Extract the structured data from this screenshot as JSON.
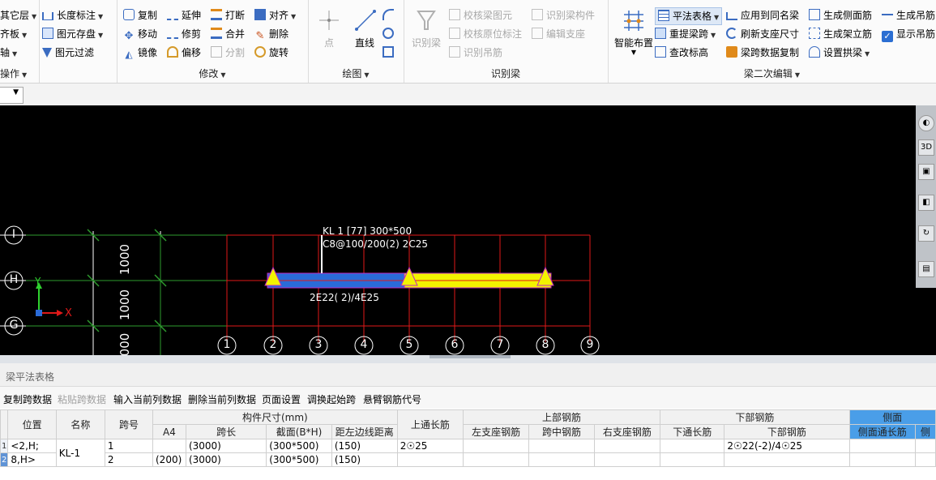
{
  "ribbon": {
    "col1": {
      "items": [
        "其它层",
        "齐板",
        "轴"
      ],
      "group": "操作"
    },
    "col2": {
      "items": [
        "长度标注",
        "图元存盘",
        "图元过滤"
      ]
    },
    "modify": {
      "items": [
        "复制",
        "延伸",
        "打断",
        "对齐",
        "移动",
        "修剪",
        "合并",
        "删除",
        "镜像",
        "偏移",
        "分割",
        "旋转"
      ],
      "group": "修改"
    },
    "draw": {
      "point": "点",
      "line": "直线",
      "group": "绘图"
    },
    "recognize": {
      "big": "识别梁",
      "items": [
        "校核梁图元",
        "识别梁构件",
        "校核原位标注",
        "编辑支座",
        "识别吊筋"
      ],
      "group": "识别梁"
    },
    "edit": {
      "smart": "智能布置",
      "items": [
        "平法表格",
        "应用到同名梁",
        "生成侧面筋",
        "生成吊筋",
        "重提梁跨",
        "刷新支座尺寸",
        "生成架立筋",
        "显示吊筋",
        "查改标高",
        "梁跨数据复制",
        "设置拱梁"
      ],
      "group": "梁二次编辑"
    }
  },
  "canvas": {
    "rows": [
      "I",
      "H",
      "G"
    ],
    "cols": [
      "1",
      "2",
      "3",
      "4",
      "5",
      "6",
      "7",
      "8",
      "9"
    ],
    "dims": [
      "1000",
      "1000",
      "000"
    ],
    "beam_label_1": "KL 1 [77] 300*500",
    "beam_label_2": "C8@100/200(2) 2C25",
    "beam_label_3": "2E22( 2)/4E25",
    "axis_x": "X",
    "axis_y": "Y"
  },
  "panel": {
    "title": "梁平法表格",
    "toolbar": [
      "复制跨数据",
      "粘贴跨数据",
      "输入当前列数据",
      "删除当前列数据",
      "页面设置",
      "调换起始跨",
      "悬臂钢筋代号"
    ],
    "headers_top": [
      "位置",
      "名称",
      "跨号",
      "构件尺寸(mm)",
      "上通长筋",
      "上部钢筋",
      "下部钢筋",
      "侧面"
    ],
    "headers_sub": [
      "A4",
      "跨长",
      "截面(B*H)",
      "距左边线距离",
      "左支座钢筋",
      "跨中钢筋",
      "右支座钢筋",
      "下通长筋",
      "下部钢筋",
      "侧面通长筋",
      "侧"
    ],
    "rows": [
      {
        "no": "1",
        "pos": "<2,H;",
        "name": "KL-1",
        "span": "1",
        "a4": "",
        "len": "(3000)",
        "sec": "(300*500)",
        "dist": "(150)",
        "top": "2☉25",
        "bottom": "2☉22(-2)/4☉25"
      },
      {
        "no": "2",
        "pos": "8,H>",
        "span": "2",
        "a4": "(200)",
        "len": "(3000)",
        "sec": "(300*500)",
        "dist": "(150)",
        "top": "",
        "bottom": ""
      }
    ]
  }
}
